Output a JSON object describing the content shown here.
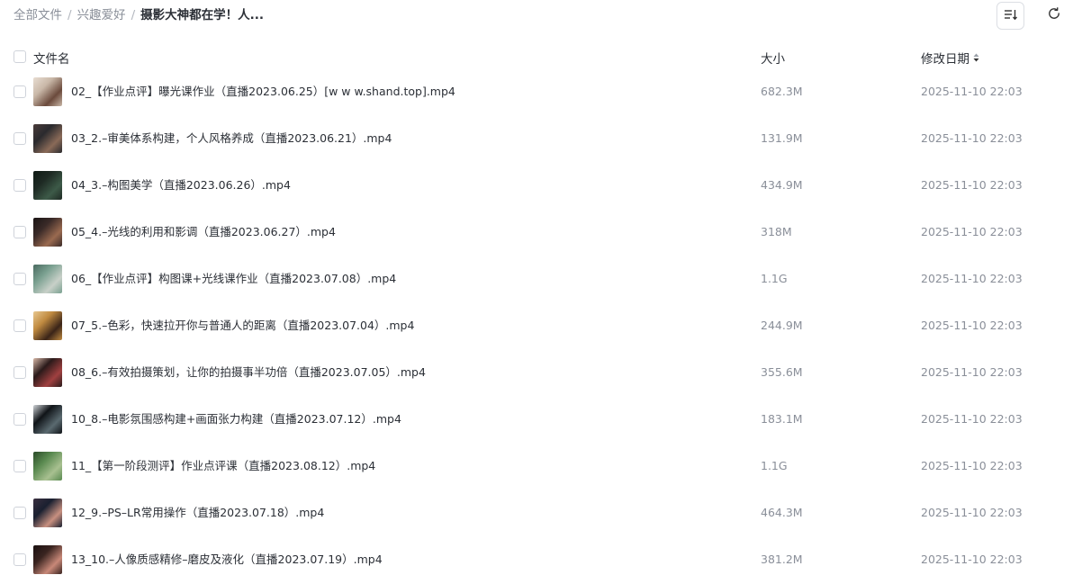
{
  "breadcrumb": {
    "root": "全部文件",
    "parent": "兴趣爱好",
    "current": "摄影大神都在学！人..."
  },
  "toolbar": {
    "sort_icon": "sort-list-icon",
    "refresh_icon": "refresh-icon"
  },
  "columns": {
    "name": "文件名",
    "size": "大小",
    "date": "修改日期"
  },
  "files": [
    {
      "name": "02_【作业点评】曝光课作业（直播2023.06.25）[w w w.shand.top].mp4",
      "size": "682.3M",
      "date": "2025-11-10 22:03",
      "thumb_colors": [
        "#c9b8a8",
        "#6b4a3c",
        "#e8ddd2"
      ]
    },
    {
      "name": "03_2.–审美体系构建，个人风格养成（直播2023.06.21）.mp4",
      "size": "131.9M",
      "date": "2025-11-10 22:03",
      "thumb_colors": [
        "#2a2a2e",
        "#8a6a58",
        "#4a3c3a"
      ]
    },
    {
      "name": "04_3.–构图美学（直播2023.06.26）.mp4",
      "size": "434.9M",
      "date": "2025-11-10 22:03",
      "thumb_colors": [
        "#1e2a24",
        "#3d5a48",
        "#0f1a14"
      ]
    },
    {
      "name": "05_4.–光线的利用和影调（直播2023.06.27）.mp4",
      "size": "318M",
      "date": "2025-11-10 22:03",
      "thumb_colors": [
        "#3a2a28",
        "#9a6a50",
        "#1a1414"
      ]
    },
    {
      "name": "06_【作业点评】构图课+光线课作业（直播2023.07.08）.mp4",
      "size": "1.1G",
      "date": "2025-11-10 22:03",
      "thumb_colors": [
        "#7aa090",
        "#c8d0c8",
        "#4a6a60"
      ]
    },
    {
      "name": "07_5.–色彩，快速拉开你与普通人的距离（直播2023.07.04）.mp4",
      "size": "244.9M",
      "date": "2025-11-10 22:03",
      "thumb_colors": [
        "#c08a40",
        "#3a2418",
        "#e8c890"
      ]
    },
    {
      "name": "08_6.–有效拍摄策划，让你的拍摄事半功倍（直播2023.07.05）.mp4",
      "size": "355.6M",
      "date": "2025-11-10 22:03",
      "thumb_colors": [
        "#2a1a1a",
        "#a04040",
        "#d8b8a8"
      ]
    },
    {
      "name": "10_8.–电影氛围感构建+画面张力构建（直播2023.07.12）.mp4",
      "size": "183.1M",
      "date": "2025-11-10 22:03",
      "thumb_colors": [
        "#101418",
        "#5a6a70",
        "#d0d4d8"
      ]
    },
    {
      "name": "11_【第一阶段测评】作业点评课（直播2023.08.12）.mp4",
      "size": "1.1G",
      "date": "2025-11-10 22:03",
      "thumb_colors": [
        "#5a8a50",
        "#a8c090",
        "#2a4a28"
      ]
    },
    {
      "name": "12_9.–PS–LR常用操作（直播2023.07.18）.mp4",
      "size": "464.3M",
      "date": "2025-11-10 22:03",
      "thumb_colors": [
        "#1a2030",
        "#c89080",
        "#3a3040"
      ]
    },
    {
      "name": "13_10.–人像质感精修–磨皮及液化（直播2023.07.19）.mp4",
      "size": "381.2M",
      "date": "2025-11-10 22:03",
      "thumb_colors": [
        "#3a2420",
        "#c88878",
        "#1a1010"
      ]
    }
  ]
}
